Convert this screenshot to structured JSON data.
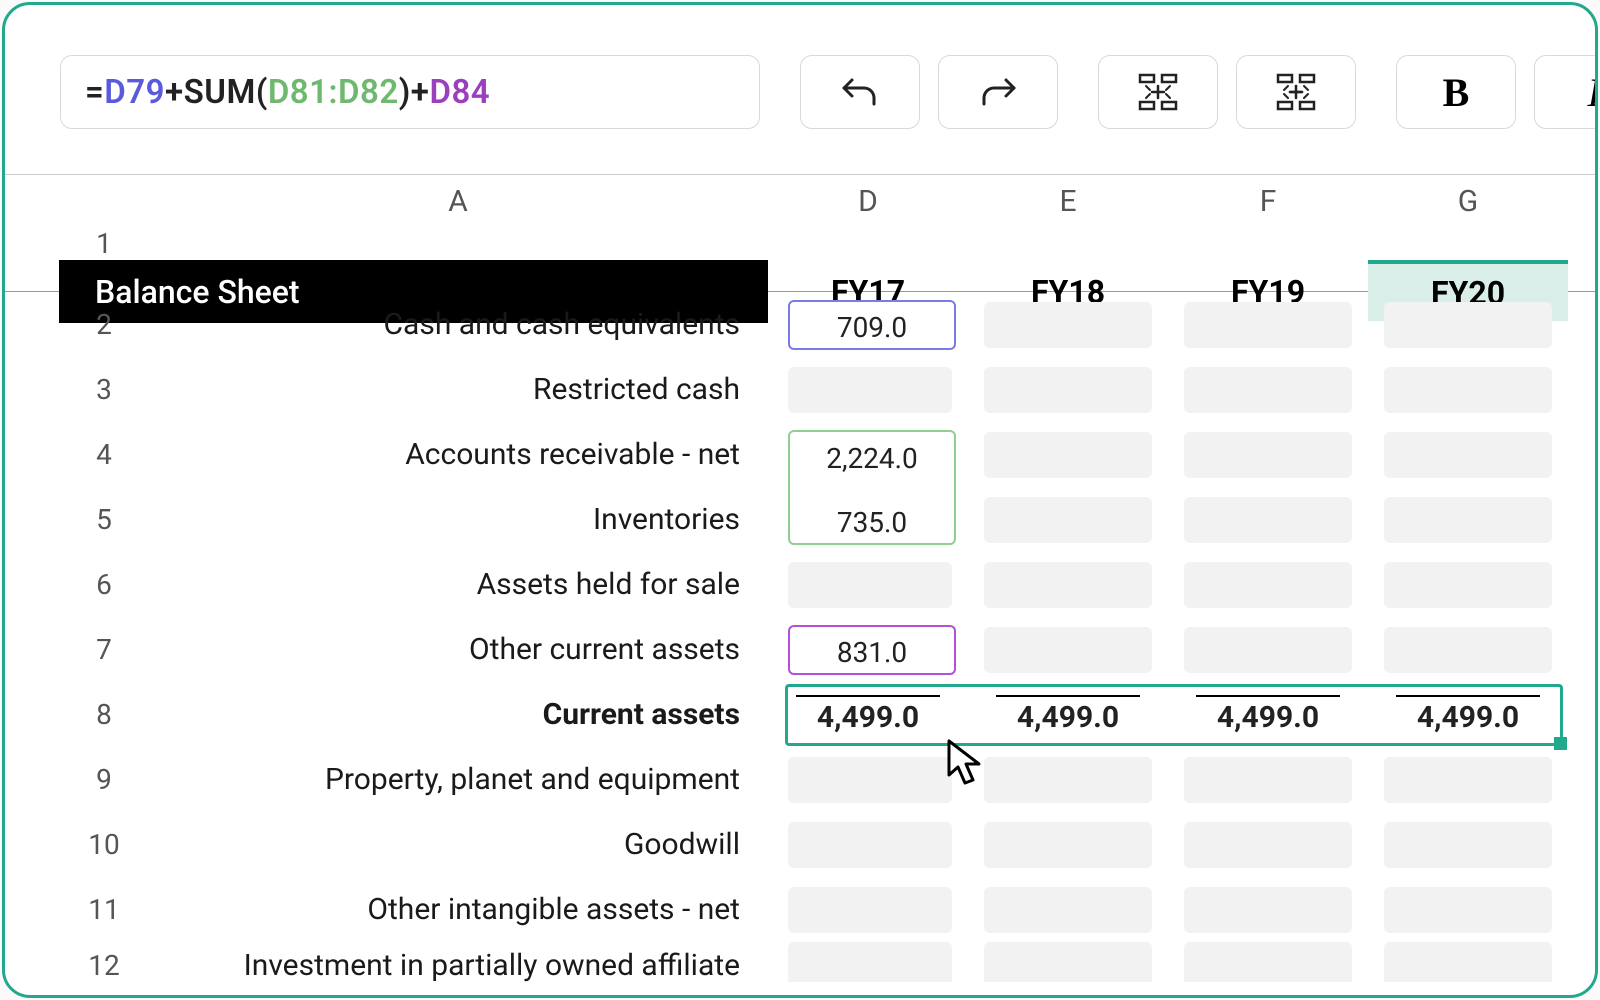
{
  "formula": {
    "eq": "=",
    "ref1": "D79",
    "plus1": "+",
    "fn": "SUM",
    "open": "(",
    "ref2a": "D81",
    "colon": ":",
    "ref2b": "D82",
    "close": ")",
    "plus2": "+",
    "ref3": "D84"
  },
  "toolbar": {
    "bold": "B",
    "italic": "I"
  },
  "columns": {
    "A": "A",
    "D": "D",
    "E": "E",
    "F": "F",
    "G": "G"
  },
  "headers": {
    "title": "Balance Sheet",
    "FY17": "FY17",
    "FY18": "FY18",
    "FY19": "FY19",
    "FY20": "FY20"
  },
  "rows": {
    "r1": "1",
    "r2": "2",
    "r3": "3",
    "r4": "4",
    "r5": "5",
    "r6": "6",
    "r7": "7",
    "r8": "8",
    "r9": "9",
    "r10": "10",
    "r11": "11",
    "r12": "12"
  },
  "labels": {
    "cash": "Cash and cash equivalents",
    "restricted": "Restricted cash",
    "ar": "Accounts receivable - net",
    "inv": "Inventories",
    "held": "Assets held for sale",
    "other_current": "Other current assets",
    "current_assets": "Current assets",
    "ppe": "Property, planet and equipment",
    "goodwill": "Goodwill",
    "intangible": "Other intangible assets - net",
    "investment": "Investment in partially owned affiliate"
  },
  "values": {
    "cash_d": "709.0",
    "ar_d": "2,224.0",
    "inv_d": "735.0",
    "other_d": "831.0",
    "sum_d": "4,499.0",
    "sum_e": "4,499.0",
    "sum_f": "4,499.0",
    "sum_g": "4,499.0"
  }
}
